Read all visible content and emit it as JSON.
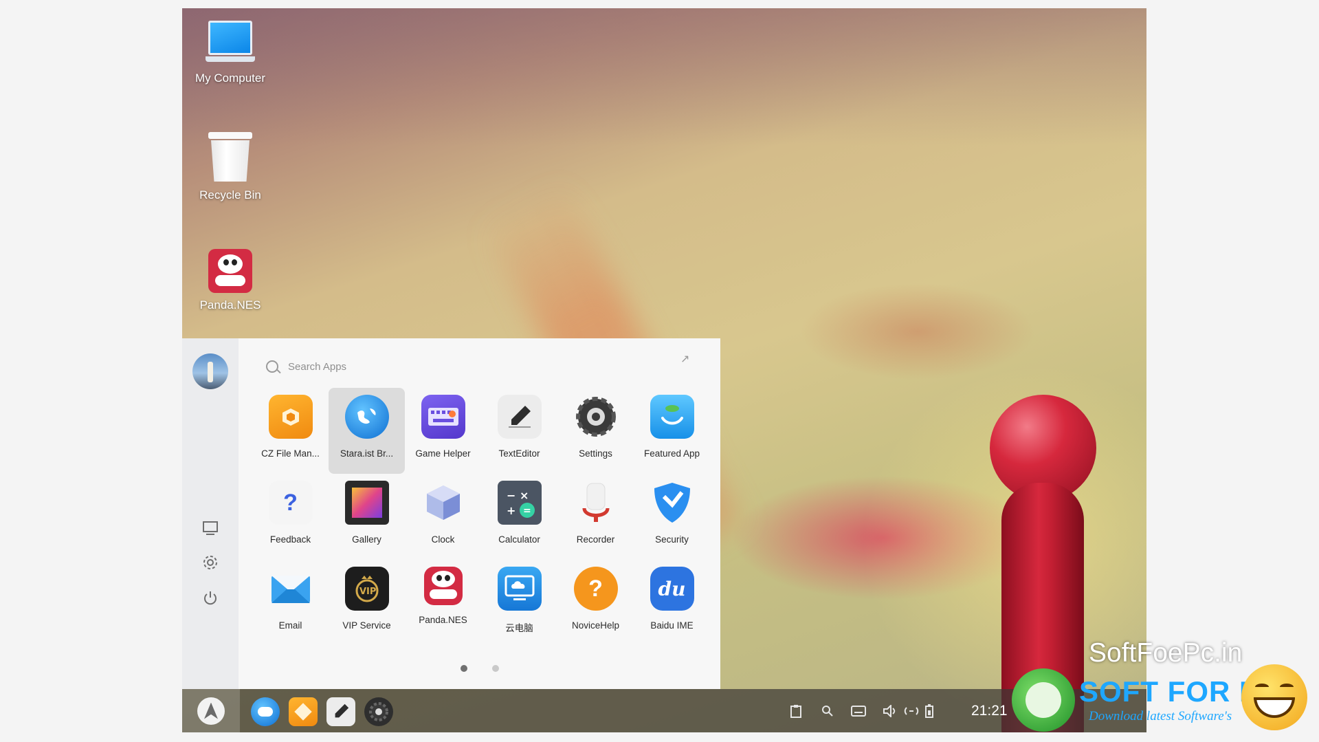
{
  "desktop": {
    "icons": [
      {
        "label": "My Computer",
        "icon": "laptop-icon"
      },
      {
        "label": "Recycle Bin",
        "icon": "trash-icon"
      },
      {
        "label": "Panda.NES",
        "icon": "panda-gamepad-icon"
      }
    ]
  },
  "launcher": {
    "search_placeholder": "Search Apps",
    "apps": [
      {
        "label": "CZ File Man...",
        "icon": "folder-cube-icon",
        "color": "#f7a21b"
      },
      {
        "label": "Stara.ist Br...",
        "icon": "globe-icon",
        "color": "#1d8ee6"
      },
      {
        "label": "Game Helper",
        "icon": "keyboard-icon",
        "color": "#6a4fe0"
      },
      {
        "label": "TextEditor",
        "icon": "pen-icon",
        "color": "#e9e9e9"
      },
      {
        "label": "Settings",
        "icon": "gear-icon",
        "color": "#3a3a3a"
      },
      {
        "label": "Featured App",
        "icon": "store-bag-icon",
        "color": "#2fa7f3"
      },
      {
        "label": "Feedback",
        "icon": "question-icon",
        "color": "#f3f3f3"
      },
      {
        "label": "Gallery",
        "icon": "picture-icon",
        "color": "#8e4bd1"
      },
      {
        "label": "Clock",
        "icon": "clock-cube-icon",
        "color": "#a9b6e6"
      },
      {
        "label": "Calculator",
        "icon": "calculator-icon",
        "color": "#4b5563"
      },
      {
        "label": "Recorder",
        "icon": "microphone-icon",
        "color": "#d23a30"
      },
      {
        "label": "Security",
        "icon": "shield-icon",
        "color": "#2a8ff0"
      },
      {
        "label": "Email",
        "icon": "envelope-icon",
        "color": "#2f9ae9"
      },
      {
        "label": "VIP Service",
        "icon": "vip-crown-icon",
        "color": "#1d1d1d"
      },
      {
        "label": "Panda.NES",
        "icon": "panda-gamepad-icon",
        "color": "#d32b43"
      },
      {
        "label": "云电脑",
        "icon": "cloud-monitor-icon",
        "color": "#1f8fe5"
      },
      {
        "label": "NoviceHelp",
        "icon": "help-circle-icon",
        "color": "#f5961d"
      },
      {
        "label": "Baidu IME",
        "icon": "baidu-du-icon",
        "color": "#2d74e0"
      }
    ],
    "page": 1,
    "pages": 2
  },
  "taskbar": {
    "time": "21:21",
    "pinned": [
      "globe-icon",
      "folder-cube-icon",
      "pen-icon",
      "gear-icon"
    ]
  },
  "watermark": {
    "site": "SoftFoePc.in",
    "title": "SOFT FOR PC",
    "subtitle": "Download latest Software's"
  }
}
